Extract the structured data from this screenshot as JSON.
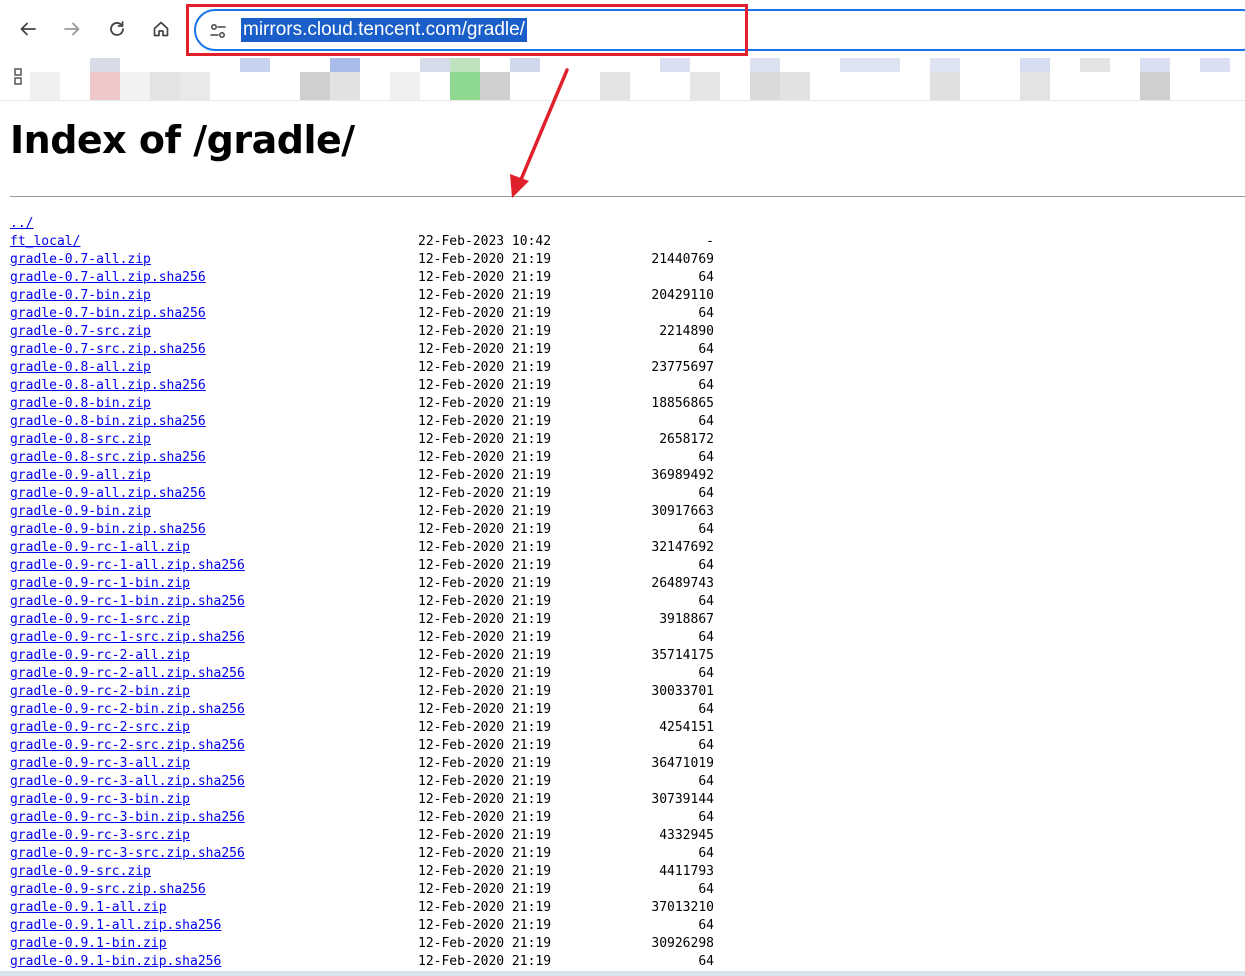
{
  "browser": {
    "url": "mirrors.cloud.tencent.com/gradle/",
    "icons": {
      "back": "arrow-left-icon",
      "forward": "arrow-right-icon",
      "reload": "reload-icon",
      "home": "home-icon",
      "site_info": "tune-icon",
      "apps": "apps-grid-icon"
    },
    "annotation_color": "#e0202a",
    "selection_color": "#1a5ec9"
  },
  "page": {
    "title": "Index of /gradle/",
    "link_color": "#0000ee",
    "entries": [
      {
        "name": "../",
        "date": "",
        "size": ""
      },
      {
        "name": "ft_local/",
        "date": "22-Feb-2023 10:42",
        "size": "-"
      },
      {
        "name": "gradle-0.7-all.zip",
        "date": "12-Feb-2020 21:19",
        "size": "21440769"
      },
      {
        "name": "gradle-0.7-all.zip.sha256",
        "date": "12-Feb-2020 21:19",
        "size": "64"
      },
      {
        "name": "gradle-0.7-bin.zip",
        "date": "12-Feb-2020 21:19",
        "size": "20429110"
      },
      {
        "name": "gradle-0.7-bin.zip.sha256",
        "date": "12-Feb-2020 21:19",
        "size": "64"
      },
      {
        "name": "gradle-0.7-src.zip",
        "date": "12-Feb-2020 21:19",
        "size": "2214890"
      },
      {
        "name": "gradle-0.7-src.zip.sha256",
        "date": "12-Feb-2020 21:19",
        "size": "64"
      },
      {
        "name": "gradle-0.8-all.zip",
        "date": "12-Feb-2020 21:19",
        "size": "23775697"
      },
      {
        "name": "gradle-0.8-all.zip.sha256",
        "date": "12-Feb-2020 21:19",
        "size": "64"
      },
      {
        "name": "gradle-0.8-bin.zip",
        "date": "12-Feb-2020 21:19",
        "size": "18856865"
      },
      {
        "name": "gradle-0.8-bin.zip.sha256",
        "date": "12-Feb-2020 21:19",
        "size": "64"
      },
      {
        "name": "gradle-0.8-src.zip",
        "date": "12-Feb-2020 21:19",
        "size": "2658172"
      },
      {
        "name": "gradle-0.8-src.zip.sha256",
        "date": "12-Feb-2020 21:19",
        "size": "64"
      },
      {
        "name": "gradle-0.9-all.zip",
        "date": "12-Feb-2020 21:19",
        "size": "36989492"
      },
      {
        "name": "gradle-0.9-all.zip.sha256",
        "date": "12-Feb-2020 21:19",
        "size": "64"
      },
      {
        "name": "gradle-0.9-bin.zip",
        "date": "12-Feb-2020 21:19",
        "size": "30917663"
      },
      {
        "name": "gradle-0.9-bin.zip.sha256",
        "date": "12-Feb-2020 21:19",
        "size": "64"
      },
      {
        "name": "gradle-0.9-rc-1-all.zip",
        "date": "12-Feb-2020 21:19",
        "size": "32147692"
      },
      {
        "name": "gradle-0.9-rc-1-all.zip.sha256",
        "date": "12-Feb-2020 21:19",
        "size": "64"
      },
      {
        "name": "gradle-0.9-rc-1-bin.zip",
        "date": "12-Feb-2020 21:19",
        "size": "26489743"
      },
      {
        "name": "gradle-0.9-rc-1-bin.zip.sha256",
        "date": "12-Feb-2020 21:19",
        "size": "64"
      },
      {
        "name": "gradle-0.9-rc-1-src.zip",
        "date": "12-Feb-2020 21:19",
        "size": "3918867"
      },
      {
        "name": "gradle-0.9-rc-1-src.zip.sha256",
        "date": "12-Feb-2020 21:19",
        "size": "64"
      },
      {
        "name": "gradle-0.9-rc-2-all.zip",
        "date": "12-Feb-2020 21:19",
        "size": "35714175"
      },
      {
        "name": "gradle-0.9-rc-2-all.zip.sha256",
        "date": "12-Feb-2020 21:19",
        "size": "64"
      },
      {
        "name": "gradle-0.9-rc-2-bin.zip",
        "date": "12-Feb-2020 21:19",
        "size": "30033701"
      },
      {
        "name": "gradle-0.9-rc-2-bin.zip.sha256",
        "date": "12-Feb-2020 21:19",
        "size": "64"
      },
      {
        "name": "gradle-0.9-rc-2-src.zip",
        "date": "12-Feb-2020 21:19",
        "size": "4254151"
      },
      {
        "name": "gradle-0.9-rc-2-src.zip.sha256",
        "date": "12-Feb-2020 21:19",
        "size": "64"
      },
      {
        "name": "gradle-0.9-rc-3-all.zip",
        "date": "12-Feb-2020 21:19",
        "size": "36471019"
      },
      {
        "name": "gradle-0.9-rc-3-all.zip.sha256",
        "date": "12-Feb-2020 21:19",
        "size": "64"
      },
      {
        "name": "gradle-0.9-rc-3-bin.zip",
        "date": "12-Feb-2020 21:19",
        "size": "30739144"
      },
      {
        "name": "gradle-0.9-rc-3-bin.zip.sha256",
        "date": "12-Feb-2020 21:19",
        "size": "64"
      },
      {
        "name": "gradle-0.9-rc-3-src.zip",
        "date": "12-Feb-2020 21:19",
        "size": "4332945"
      },
      {
        "name": "gradle-0.9-rc-3-src.zip.sha256",
        "date": "12-Feb-2020 21:19",
        "size": "64"
      },
      {
        "name": "gradle-0.9-src.zip",
        "date": "12-Feb-2020 21:19",
        "size": "4411793"
      },
      {
        "name": "gradle-0.9-src.zip.sha256",
        "date": "12-Feb-2020 21:19",
        "size": "64"
      },
      {
        "name": "gradle-0.9.1-all.zip",
        "date": "12-Feb-2020 21:19",
        "size": "37013210"
      },
      {
        "name": "gradle-0.9.1-all.zip.sha256",
        "date": "12-Feb-2020 21:19",
        "size": "64"
      },
      {
        "name": "gradle-0.9.1-bin.zip",
        "date": "12-Feb-2020 21:19",
        "size": "30926298"
      },
      {
        "name": "gradle-0.9.1-bin.zip.sha256",
        "date": "12-Feb-2020 21:19",
        "size": "64"
      }
    ]
  }
}
